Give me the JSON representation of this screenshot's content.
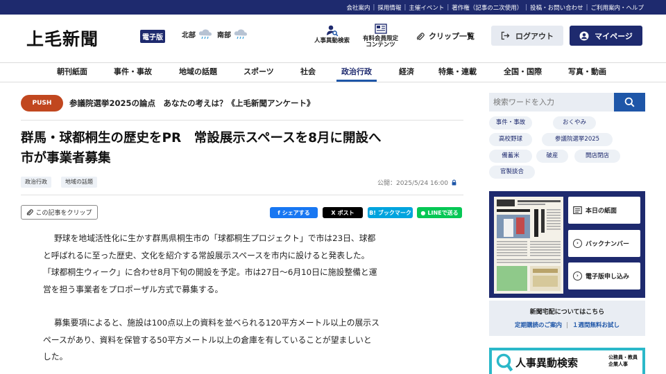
{
  "topbar": {
    "links": [
      "会社案内",
      "採用情報",
      "主催イベント",
      "著作権（記事の二次使用）",
      "投稿・お問い合わせ",
      "ご利用案内・ヘルプ"
    ]
  },
  "header": {
    "logo": "上毛新聞",
    "logo_badge": "電子版",
    "weather": [
      {
        "region": "北部"
      },
      {
        "region": "南部"
      }
    ],
    "personnel_search": "人事異動検索",
    "paid_content": [
      "有料会員限定",
      "コンテンツ"
    ],
    "clip_list": "クリップ一覧",
    "logout": "ログアウト",
    "mypage": "マイページ"
  },
  "nav": {
    "items": [
      "朝刊紙面",
      "事件・事故",
      "地域の話題",
      "スポーツ",
      "社会",
      "政治行政",
      "経済",
      "特集・連載",
      "全国・国際",
      "写真・動画"
    ],
    "active": "政治行政"
  },
  "push": {
    "badge": "PUSH",
    "text": "参議院選挙2025の論点　あなたの考えは？《上毛新聞アンケート》"
  },
  "article": {
    "title_lines": [
      "群馬・球都桐生の歴史をPR　常設展示スペースを8月に開設へ",
      "市が事業者募集"
    ],
    "tags": [
      "政治行政",
      "地域の話題"
    ],
    "published": "公開：2025/5/24 16:00",
    "clip_button": "この記事をクリップ",
    "share": {
      "facebook": "シェアする",
      "x": "ポスト",
      "hatena": "ブックマーク",
      "line": "LINEで送る"
    },
    "paragraph1_lines": [
      "野球を地域活性化に生かす群馬県桐生市の「球都桐生プロジェクト」で市は23日、球都",
      "と呼ばれるに至った歴史、文化を紹介する常設展示スペースを市内に設けると発表した。",
      "「球都桐生ウィーク」に合わせ8月下旬の開設を予定。市は27日〜6月10日に施設整備と運",
      "営を担う事業者をプロポーザル方式で募集する。"
    ],
    "paragraph2_lines": [
      "募集要項によると、施設は100点以上の資料を並べられる120平方メートル以上の展示ス",
      "ペースがあり、資料を保管する50平方メートル以上の倉庫を有していることが望ましいと",
      "した。"
    ]
  },
  "sidebar": {
    "search_placeholder": "検索ワードを入力",
    "keywords": [
      "事件・事故",
      "おくやみ",
      "高校野球",
      "参議院選挙2025",
      "備蓄米",
      "破産",
      "開店閉店",
      "官製談合"
    ],
    "paper_buttons": [
      "本日の紙面",
      "バックナンバー",
      "電子版申し込み"
    ],
    "delivery": {
      "title": "新聞宅配についてはこちら",
      "links": [
        "定期購読のご案内",
        "１週間無料お試し"
      ]
    },
    "jinji_banner": {
      "title": "人事異動検索",
      "sub": [
        "公務員・教員",
        "企業人事"
      ]
    }
  },
  "colors": {
    "navy": "#1e2a6e",
    "accent_blue": "#1e56a8",
    "push_badge": "#c1471f",
    "facebook": "#1877f2",
    "x": "#000000",
    "hatena": "#00a4de",
    "line": "#06c755",
    "banner_teal": "#2bb8c9"
  }
}
